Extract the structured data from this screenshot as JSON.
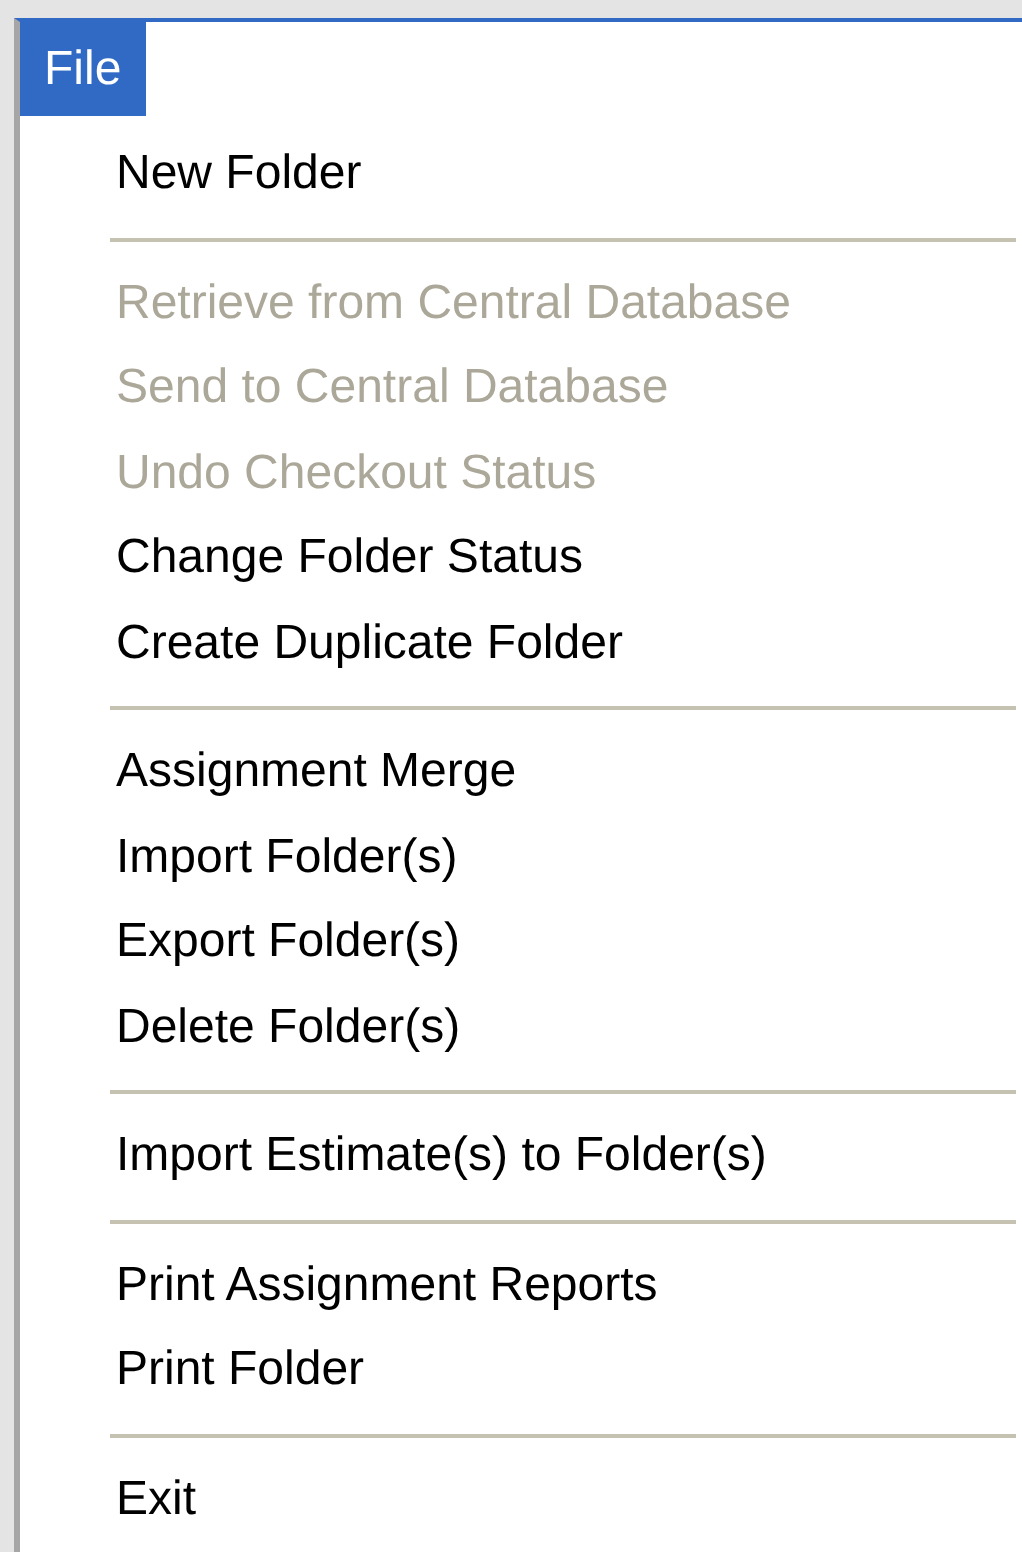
{
  "menu_bar": [
    {
      "label": "File",
      "selected": true
    }
  ],
  "menu_groups": [
    [
      {
        "label": "New Folder",
        "disabled": false
      }
    ],
    [
      {
        "label": "Retrieve from Central Database",
        "disabled": true
      },
      {
        "label": "Send to Central Database",
        "disabled": true
      },
      {
        "label": "Undo Checkout Status",
        "disabled": true
      },
      {
        "label": "Change Folder Status",
        "disabled": false
      },
      {
        "label": "Create Duplicate Folder",
        "disabled": false
      }
    ],
    [
      {
        "label": "Assignment Merge",
        "disabled": false
      },
      {
        "label": "Import Folder(s)",
        "disabled": false
      },
      {
        "label": "Export Folder(s)",
        "disabled": false
      },
      {
        "label": "Delete Folder(s)",
        "disabled": false
      }
    ],
    [
      {
        "label": "Import Estimate(s) to Folder(s)",
        "disabled": false
      }
    ],
    [
      {
        "label": "Print Assignment Reports",
        "disabled": false
      },
      {
        "label": "Print Folder",
        "disabled": false
      }
    ],
    [
      {
        "label": "Exit",
        "disabled": false
      }
    ]
  ]
}
